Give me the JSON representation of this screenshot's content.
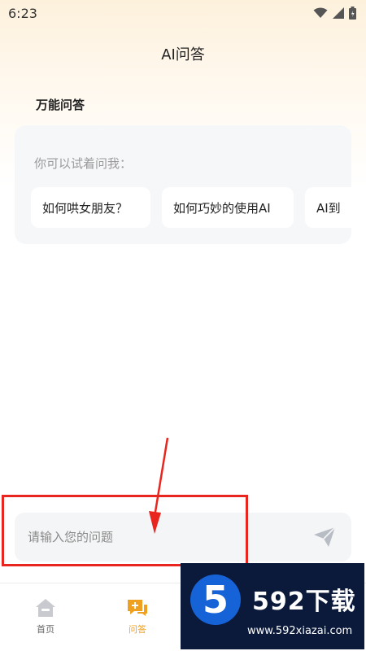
{
  "status_bar": {
    "time": "6:23"
  },
  "header": {
    "title": "AI问答"
  },
  "section": {
    "title": "万能问答"
  },
  "suggestions": {
    "hint": "你可以试着问我：",
    "chips": [
      "如何哄女朋友？",
      "如何巧妙的使用AI",
      "AI到"
    ]
  },
  "input": {
    "placeholder": "请输入您的问题"
  },
  "bottom_nav": {
    "items": [
      {
        "label": "首页",
        "icon": "home-icon",
        "active": false
      },
      {
        "label": "问答",
        "icon": "chat-plus-icon",
        "active": true
      }
    ]
  },
  "watermark": {
    "logo_digit": "5",
    "brand": "592下载",
    "url": "www.592xiazai.com"
  },
  "colors": {
    "accent": "#f0a020",
    "annotation": "#e8261f",
    "watermark_bg": "#0b1a3a"
  }
}
